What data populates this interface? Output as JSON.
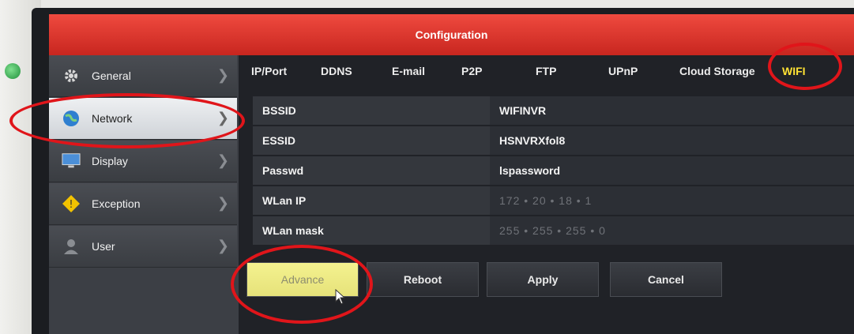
{
  "window": {
    "title": "Configuration"
  },
  "sidebar": {
    "items": [
      {
        "label": "General",
        "icon": "gear-icon",
        "active": false
      },
      {
        "label": "Network",
        "icon": "globe-icon",
        "active": true
      },
      {
        "label": "Display",
        "icon": "monitor-icon",
        "active": false
      },
      {
        "label": "Exception",
        "icon": "warning-icon",
        "active": false
      },
      {
        "label": "User",
        "icon": "user-icon",
        "active": false
      }
    ]
  },
  "tabs": [
    {
      "label": "IP/Port"
    },
    {
      "label": "DDNS"
    },
    {
      "label": "E-mail"
    },
    {
      "label": "P2P"
    },
    {
      "label": "FTP"
    },
    {
      "label": "UPnP"
    },
    {
      "label": "Cloud Storage"
    },
    {
      "label": "WIFI",
      "active": true
    }
  ],
  "form": {
    "rows": [
      {
        "label": "BSSID",
        "value": "WIFINVR"
      },
      {
        "label": "ESSID",
        "value": "HSNVRXfol8"
      },
      {
        "label": "Passwd",
        "value": "lspassword"
      },
      {
        "label": "WLan IP",
        "value": "172  •  20  •  18  •  1"
      },
      {
        "label": "WLan mask",
        "value": "255  •  255  •  255  •  0"
      }
    ]
  },
  "buttons": {
    "advance": "Advance",
    "reboot": "Reboot",
    "apply": "Apply",
    "cancel": "Cancel"
  },
  "colors": {
    "title_bar": "#d9342b",
    "active_tab": "#ffe234",
    "annotation": "#e0151a",
    "highlight_button": "#efed86"
  }
}
